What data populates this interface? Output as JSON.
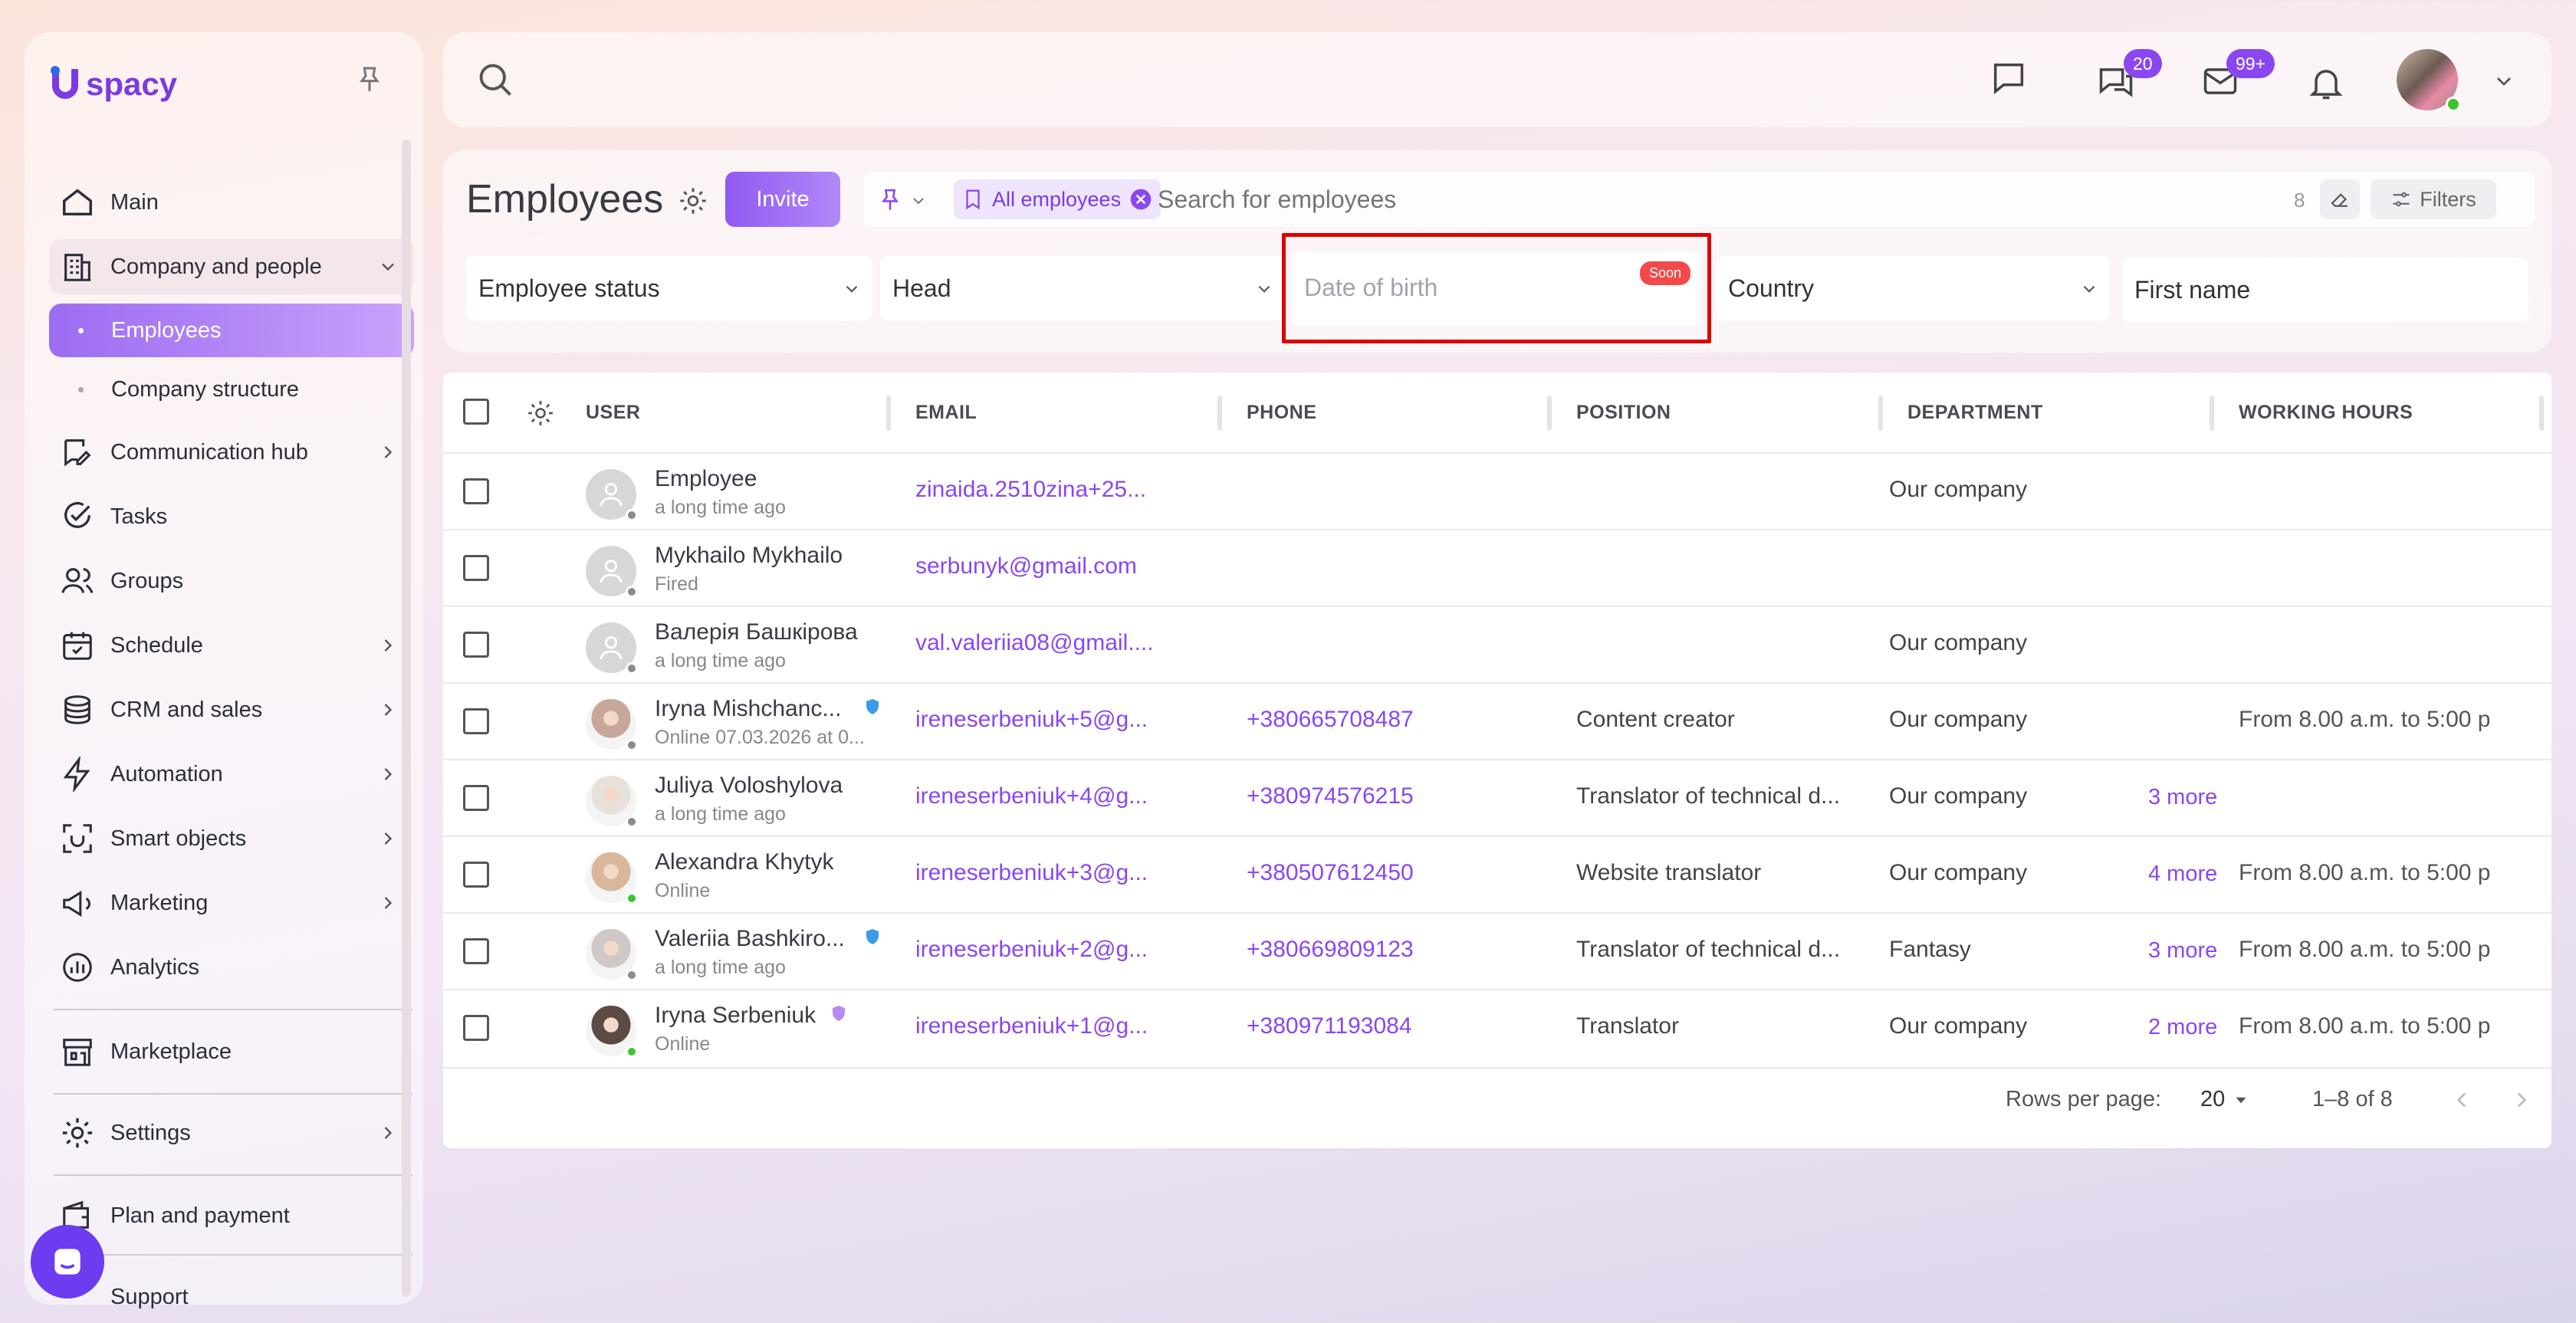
{
  "app": {
    "brand": "spacy"
  },
  "sidebar": {
    "items": [
      {
        "label": "Main",
        "icon": "home-icon"
      },
      {
        "label": "Company and people",
        "icon": "building-icon"
      },
      {
        "label": "Employees"
      },
      {
        "label": "Company structure"
      },
      {
        "label": "Communication hub",
        "icon": "chat-edit-icon"
      },
      {
        "label": "Tasks",
        "icon": "check-circle-icon"
      },
      {
        "label": "Groups",
        "icon": "users-icon"
      },
      {
        "label": "Schedule",
        "icon": "calendar-icon"
      },
      {
        "label": "CRM and sales",
        "icon": "coins-icon"
      },
      {
        "label": "Automation",
        "icon": "lightning-icon"
      },
      {
        "label": "Smart objects",
        "icon": "scan-icon"
      },
      {
        "label": "Marketing",
        "icon": "megaphone-icon"
      },
      {
        "label": "Analytics",
        "icon": "analytics-icon"
      },
      {
        "label": "Marketplace",
        "icon": "store-icon"
      },
      {
        "label": "Settings",
        "icon": "gear-icon"
      },
      {
        "label": "Plan and payment",
        "icon": "wallet-icon"
      },
      {
        "label": "Support",
        "icon": "support-icon"
      }
    ]
  },
  "topbar": {
    "chats_badge": "20",
    "mail_badge": "99+"
  },
  "page": {
    "title": "Employees",
    "invite_label": "Invite",
    "chip_label": "All employees",
    "search_placeholder": "Search for employees",
    "count": "8",
    "filters_label": "Filters"
  },
  "filters": {
    "status": "Employee status",
    "head": "Head",
    "dob_placeholder": "Date of birth",
    "soon": "Soon",
    "country": "Country",
    "first_name": "First name"
  },
  "table": {
    "columns": [
      "USER",
      "EMAIL",
      "PHONE",
      "POSITION",
      "DEPARTMENT",
      "WORKING HOURS"
    ],
    "rows": [
      {
        "name": "Employee",
        "status": "a long time ago",
        "email": "zinaida.2510zina+25...",
        "phone": "",
        "position": "",
        "department": "Our company",
        "more": "",
        "hours": ""
      },
      {
        "name": "Mykhailo Mykhailo",
        "status": "Fired",
        "email": "serbunyk@gmail.com",
        "phone": "",
        "position": "",
        "department": "",
        "more": "",
        "hours": ""
      },
      {
        "name": "Валерія Башкірова",
        "status": "a long time ago",
        "email": "val.valeriia08@gmail....",
        "phone": "",
        "position": "",
        "department": "Our company",
        "more": "",
        "hours": ""
      },
      {
        "name": "Iryna Mishchanc...",
        "status": "Online 07.03.2026 at 0...",
        "email": "ireneserbeniuk+5@g...",
        "phone": "+380665708487",
        "position": "Content creator",
        "department": "Our company",
        "more": "",
        "hours": "From 8.00 a.m. to 5:00 p"
      },
      {
        "name": "Juliya Voloshylova",
        "status": "a long time ago",
        "email": "ireneserbeniuk+4@g...",
        "phone": "+380974576215",
        "position": "Translator of technical d...",
        "department": "Our company",
        "more": "3 more",
        "hours": ""
      },
      {
        "name": "Alexandra Khytyk",
        "status": "Online",
        "email": "ireneserbeniuk+3@g...",
        "phone": "+380507612450",
        "position": "Website translator",
        "department": "Our company",
        "more": "4 more",
        "hours": "From 8.00 a.m. to 5:00 p"
      },
      {
        "name": "Valeriia Bashkiro...",
        "status": "a long time ago",
        "email": "ireneserbeniuk+2@g...",
        "phone": "+380669809123",
        "position": "Translator of technical d...",
        "department": "Fantasy",
        "more": "3 more",
        "hours": "From 8.00 a.m. to 5:00 p"
      },
      {
        "name": "Iryna Serbeniuk",
        "status": "Online",
        "email": "ireneserbeniuk+1@g...",
        "phone": "+380971193084",
        "position": "Translator",
        "department": "Our company",
        "more": "2 more",
        "hours": "From 8.00 a.m. to 5:00 p"
      }
    ]
  },
  "footer": {
    "rows_label": "Rows per page:",
    "rows_value": "20",
    "range": "1–8 of 8"
  },
  "colors": {
    "accent": "#8a47f0",
    "highlight": "#e00000",
    "soon": "#f24a4a"
  }
}
